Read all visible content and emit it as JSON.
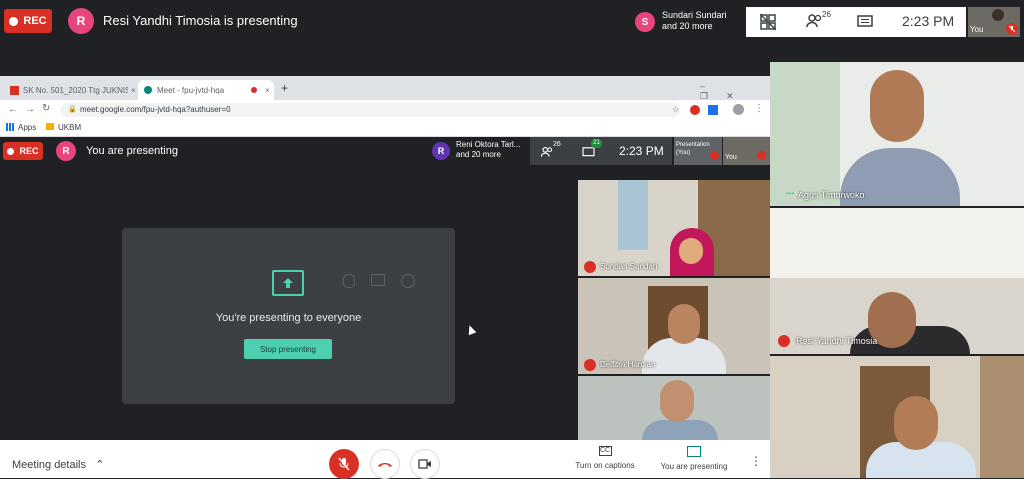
{
  "top": {
    "rec_label": "REC",
    "presenter_initial": "R",
    "presenter_text": "Resi Yandhi Timosia is presenting",
    "participant_initial": "S",
    "participant_name": "Sundari Sundari",
    "participant_more": "and 20 more",
    "people_count": "26",
    "time": "2:23 PM",
    "self_label": "You"
  },
  "browser": {
    "tabs": [
      {
        "label": "SK No. 501_2020 Ttg JUKNIS PPDB"
      },
      {
        "label": "Meet - fpu-jvtd-hqa"
      }
    ],
    "url": "meet.google.com/fpu-jvtd-hqa?authuser=0",
    "bookmarks": [
      "Apps",
      "UKBM"
    ]
  },
  "inner": {
    "rec_label": "REC",
    "presenter_initial": "R",
    "presenter_text": "You are presenting",
    "participant_initial": "R",
    "participant_name": "Reni Oktora Tarl...",
    "participant_more": "and 20 more",
    "people_count": "26",
    "chat_count": "21",
    "time": "2:23 PM",
    "tile_presentation": "Presentation (You)",
    "tile_you": "You",
    "presenting_message": "You're presenting to everyone",
    "stop_button": "Stop presenting"
  },
  "inner_tiles": [
    {
      "name": "Sundari Sundari"
    },
    {
      "name": "Delfitra Hardian"
    },
    {
      "name": ""
    }
  ],
  "right_tiles": [
    {
      "name": "Agus Timorwoko"
    },
    {
      "name": "Resi Yandhi Timosia"
    },
    {
      "name": ""
    }
  ],
  "bottom": {
    "meeting_details": "Meeting details",
    "captions_label": "Turn on captions",
    "presenting_label": "You are presenting"
  },
  "colors": {
    "red": "#d93025",
    "teal": "#00897b",
    "bar": "#202124",
    "accent": "#4dd0b0"
  }
}
